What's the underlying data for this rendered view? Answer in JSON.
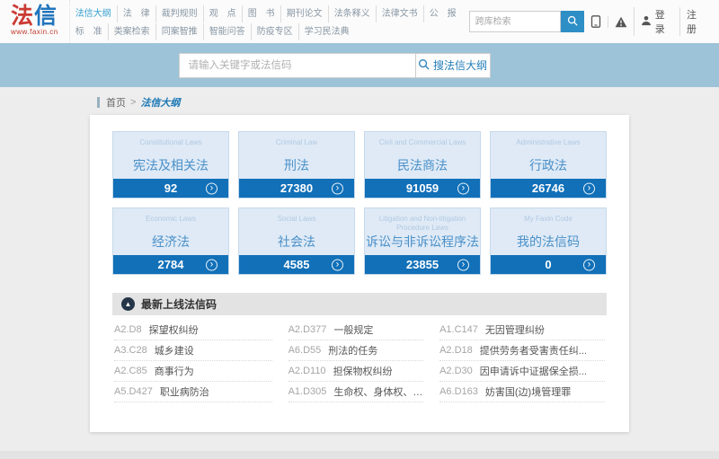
{
  "header": {
    "logo": {
      "part1": "法",
      "part2": "信",
      "url": "www.faxin.cn"
    },
    "nav_row1": [
      {
        "label": "法信大纲",
        "active": true
      },
      {
        "label": "法　律",
        "active": false
      },
      {
        "label": "裁判规则",
        "active": false
      },
      {
        "label": "观　点",
        "active": false
      },
      {
        "label": "图　书",
        "active": false
      },
      {
        "label": "期刊论文",
        "active": false
      },
      {
        "label": "法条释义",
        "active": false
      },
      {
        "label": "法律文书",
        "active": false
      },
      {
        "label": "公　报",
        "active": false
      }
    ],
    "nav_row2": [
      {
        "label": "标　准",
        "active": false
      },
      {
        "label": "类案检索",
        "active": false
      },
      {
        "label": "同案智推",
        "active": false
      },
      {
        "label": "智能问答",
        "active": false
      },
      {
        "label": "防疫专区",
        "active": false
      },
      {
        "label": "学习民法典",
        "active": false
      }
    ],
    "mini_search": {
      "placeholder": "跨库检索"
    },
    "tools": {
      "login_label": "登录",
      "register_label": "注册"
    }
  },
  "main_search": {
    "placeholder": "请输入关键字或法信码",
    "button_label": "搜法信大纲"
  },
  "breadcrumb": {
    "home": "首页",
    "separator": ">",
    "current": "法信大纲"
  },
  "categories": [
    {
      "en": "Constitutional Laws",
      "zh": "宪法及相关法",
      "count": "92"
    },
    {
      "en": "Criminal Law",
      "zh": "刑法",
      "count": "27380"
    },
    {
      "en": "Civil and Commercial Laws",
      "zh": "民法商法",
      "count": "91059"
    },
    {
      "en": "Administrative Laws",
      "zh": "行政法",
      "count": "26746"
    },
    {
      "en": "Economic Laws",
      "zh": "经济法",
      "count": "2784"
    },
    {
      "en": "Social Laws",
      "zh": "社会法",
      "count": "4585"
    },
    {
      "en": "Litigation and Non-litigation Procedure Laws",
      "zh": "诉讼与非诉讼程序法",
      "count": "23855"
    },
    {
      "en": "My Faxin Code",
      "zh": "我的法信码",
      "count": "0"
    }
  ],
  "latest": {
    "title": "最新上线法信码",
    "items": [
      {
        "code": "A2.D8",
        "title": "探望权纠纷"
      },
      {
        "code": "A2.D377",
        "title": "一般规定"
      },
      {
        "code": "A1.C147",
        "title": "无因管理纠纷"
      },
      {
        "code": "A3.C28",
        "title": "城乡建设"
      },
      {
        "code": "A6.D55",
        "title": "刑法的任务"
      },
      {
        "code": "A2.D18",
        "title": "提供劳务者受害责任纠..."
      },
      {
        "code": "A2.C85",
        "title": "商事行为"
      },
      {
        "code": "A2.D110",
        "title": "担保物权纠纷"
      },
      {
        "code": "A2.D30",
        "title": "因申请诉中证据保全损..."
      },
      {
        "code": "A5.D427",
        "title": "职业病防治"
      },
      {
        "code": "A1.D305",
        "title": "生命权、身体权、健康..."
      },
      {
        "code": "A6.D163",
        "title": "妨害国(边)境管理罪"
      }
    ]
  },
  "icons": {
    "card_arrow_glyph": "›",
    "latest_badge_glyph": "▲"
  },
  "colors": {
    "accent_blue": "#1170b8",
    "band_blue": "#9dc3d8",
    "nav_active": "#36a0cf",
    "logo_red": "#cb3a32",
    "logo_blue": "#2175bc"
  }
}
